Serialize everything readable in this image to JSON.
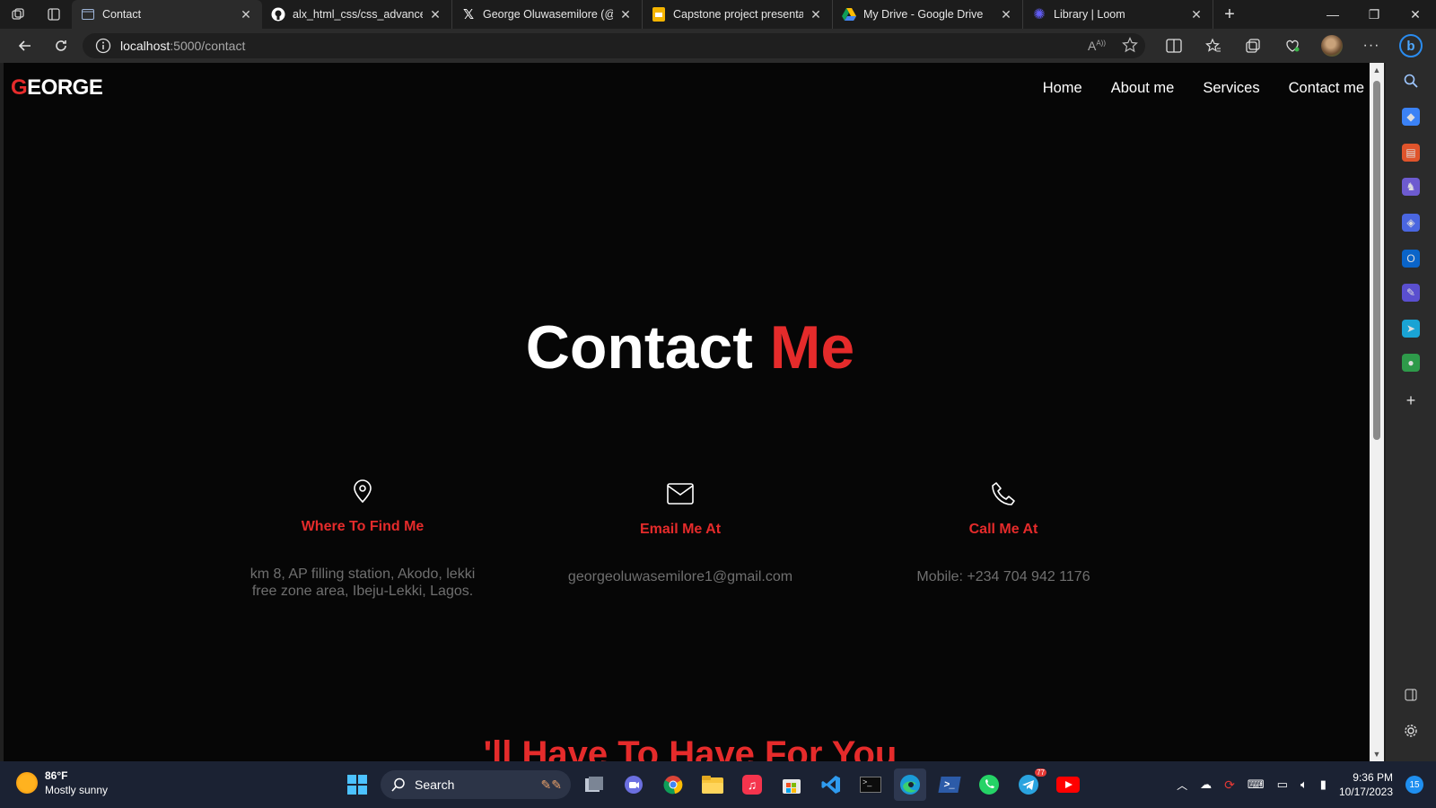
{
  "browser": {
    "tabs": [
      {
        "title": "Contact",
        "active": true,
        "icon": "page-icon"
      },
      {
        "title": "alx_html_css/css_advanced a",
        "active": false,
        "icon": "github-icon"
      },
      {
        "title": "George Oluwasemilore (@Se",
        "active": false,
        "icon": "x-logo-icon"
      },
      {
        "title": "Capstone project presentatio",
        "active": false,
        "icon": "slides-icon"
      },
      {
        "title": "My Drive - Google Drive",
        "active": false,
        "icon": "google-drive-icon"
      },
      {
        "title": "Library | Loom",
        "active": false,
        "icon": "loom-icon"
      }
    ],
    "url_host": "localhost",
    "url_path": ":5000/contact",
    "read_aloud_glyph": "A",
    "read_aloud_sup": "A))"
  },
  "site": {
    "logo_first": "G",
    "logo_rest": "EORGE",
    "nav": [
      "Home",
      "About me",
      "Services",
      "Contact me"
    ],
    "hero_white": "Contact",
    "hero_red": "Me",
    "cards": [
      {
        "icon": "map-pin-icon",
        "title": "Where To Find Me",
        "text_line1": "km 8, AP filling station, Akodo, lekki",
        "text_line2": "free zone area, Ibeju-Lekki, Lagos."
      },
      {
        "icon": "envelope-icon",
        "title": "Email Me At",
        "text_line1": "georgeoluwasemilore1@gmail.com",
        "text_line2": ""
      },
      {
        "icon": "phone-icon",
        "title": "Call Me At",
        "text_line1": "Mobile: +234 704 942 1176",
        "text_line2": ""
      }
    ],
    "next_heading_partial": "'ll Have To Have For You"
  },
  "taskbar": {
    "weather_temp": "86°F",
    "weather_desc": "Mostly sunny",
    "search_label": "Search",
    "time": "9:36 PM",
    "date": "10/17/2023",
    "notification_count": "15",
    "telegram_badge": "77"
  },
  "colors": {
    "accent": "#e52b2b",
    "page_bg": "#060606",
    "muted_text": "#6f6f6f"
  }
}
